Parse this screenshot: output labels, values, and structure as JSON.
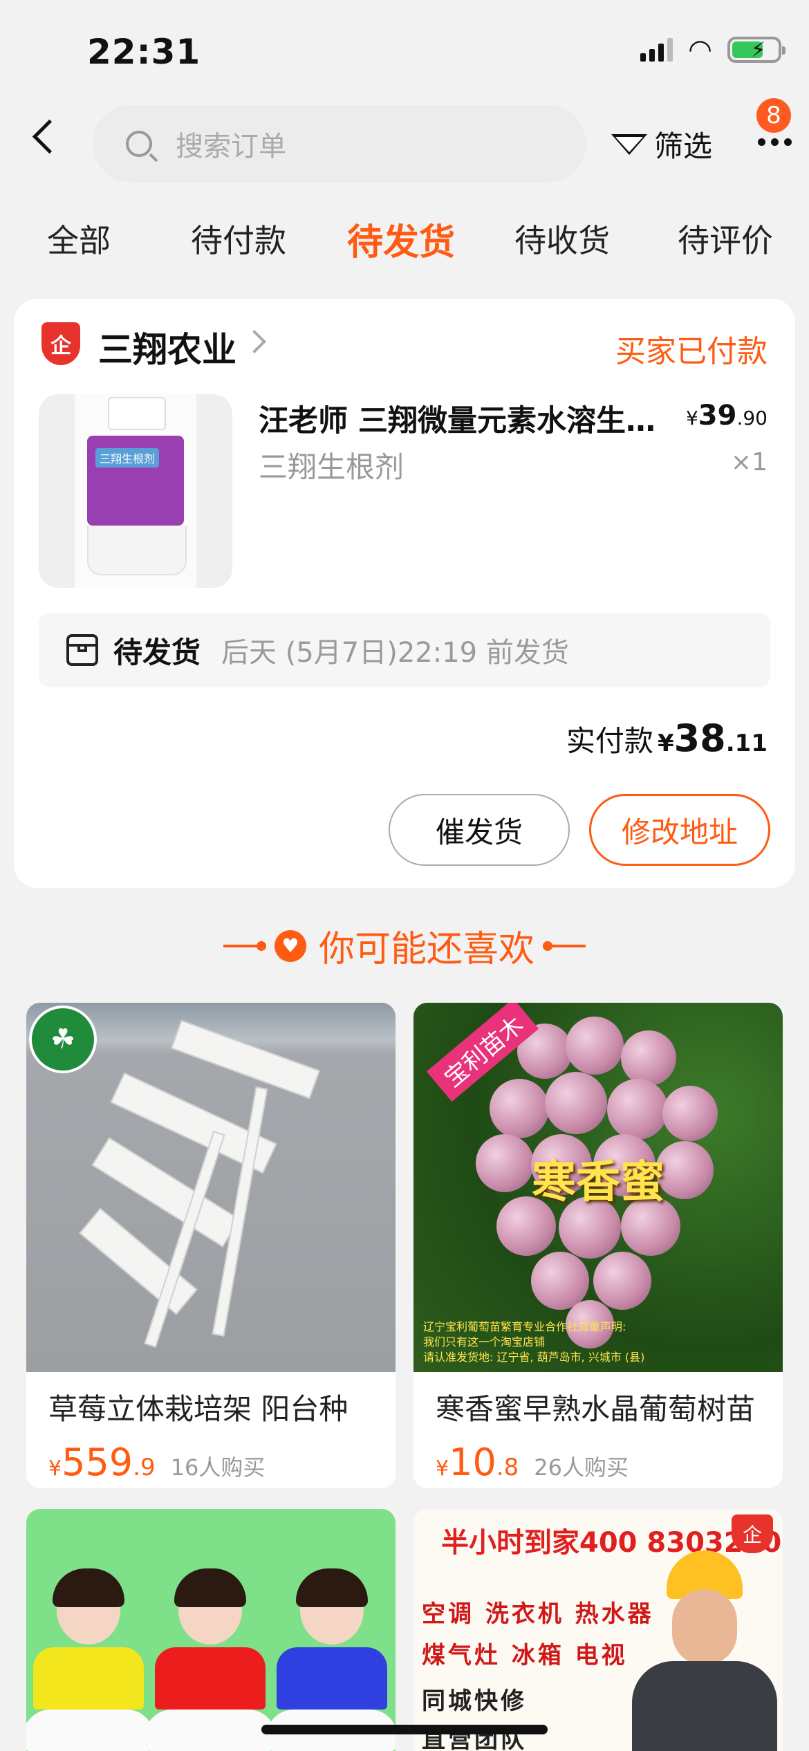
{
  "status_bar": {
    "time": "22:31"
  },
  "header": {
    "search_placeholder": "搜索订单",
    "filter_label": "筛选",
    "more_badge": "8"
  },
  "tabs": [
    {
      "label": "全部",
      "active": false
    },
    {
      "label": "待付款",
      "active": false
    },
    {
      "label": "待发货",
      "active": true
    },
    {
      "label": "待收货",
      "active": false
    },
    {
      "label": "待评价",
      "active": false
    }
  ],
  "order": {
    "shop_badge": "企",
    "shop_name": "三翔农业",
    "status": "买家已付款",
    "product_title": "汪老师 三翔微量元素水溶生根剂",
    "price_symbol": "¥",
    "price_int": "39",
    "price_dec": ".90",
    "spec": "三翔生根剂",
    "qty": "×1",
    "bottle_label": "三翔生根剂",
    "ship_label": "待发货",
    "ship_note": "后天 (5月7日)22:19 前发货",
    "paid_label": "实付款",
    "paid_symbol": "¥",
    "paid_int": "38",
    "paid_dec": ".11",
    "btn_urge": "催发货",
    "btn_address": "修改地址"
  },
  "recommend": {
    "title": "你可能还喜欢",
    "items": [
      {
        "name": "草莓立体栽培架 阳台种",
        "symbol": "¥",
        "price_int": "559",
        "price_dec": ".9",
        "buyers": "16人购买"
      },
      {
        "name": "寒香蜜早熟水晶葡萄树苗",
        "symbol": "¥",
        "price_int": "10",
        "price_dec": ".8",
        "buyers": "26人购买",
        "img_title": "寒香蜜",
        "img_tag": "宝利苗木",
        "img_note": [
          "辽宁宝利葡萄苗繁育专业合作社郑重声明:",
          "我们只有这一个淘宝店铺",
          "请认准发货地: 辽宁省, 葫芦岛市, 兴城市 (县)"
        ]
      },
      {
        "name": "",
        "kid_colors": [
          "#f3e61c",
          "#ee1d1d",
          "#2f3fe0"
        ]
      },
      {
        "name": "",
        "ad_top": "半小时到家400 8303220",
        "ad_line1": "空调 洗衣机 热水器",
        "ad_line2": "煤气灶 冰箱 电视",
        "ad_line3": "同城快修",
        "ad_line4": "直营团队",
        "ad_badge": "企"
      }
    ]
  },
  "colors": {
    "accent": "#ff5b12",
    "badge": "#ff5a1f"
  }
}
